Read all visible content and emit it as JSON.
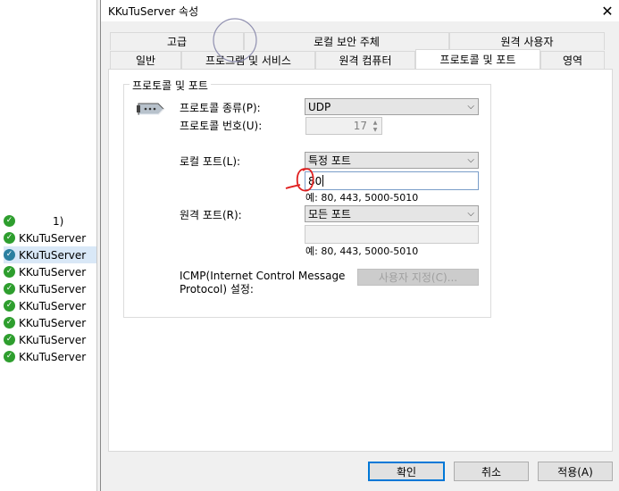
{
  "background_list": {
    "partial_label": "1)",
    "items": [
      "KKuTuServer",
      "KKuTuServer",
      "KKuTuServer",
      "KKuTuServer",
      "KKuTuServer",
      "KKuTuServer",
      "KKuTuServer",
      "KKuTuServer"
    ],
    "selected_index": 1
  },
  "dialog": {
    "title": "KKuTuServer 속성",
    "close_glyph": "✕",
    "tabs_top": [
      "고급",
      "로컬 보안 주체",
      "원격 사용자"
    ],
    "tabs_bottom": [
      "일반",
      "프로그램 및 서비스",
      "원격 컴퓨터",
      "프로토콜 및 포트",
      "영역"
    ],
    "active_tab": "프로토콜 및 포트",
    "group_title": "프로토콜 및 포트",
    "protocol_type_label": "프로토콜 종류(P):",
    "protocol_type_value": "UDP",
    "protocol_number_label": "프로토콜 번호(U):",
    "protocol_number_value": "17",
    "local_port_label": "로컬 포트(L):",
    "local_port_mode": "특정 포트",
    "local_port_value": "80",
    "local_port_hint": "예: 80, 443, 5000-5010",
    "remote_port_label": "원격 포트(R):",
    "remote_port_mode": "모든 포트",
    "remote_port_value": "",
    "remote_port_hint": "예: 80, 443, 5000-5010",
    "icmp_label_line1": "ICMP(Internet Control Message",
    "icmp_label_line2": "Protocol) 설정:",
    "customize_button": "사용자 지정(C)...",
    "ok_button": "확인",
    "cancel_button": "취소",
    "apply_button": "적용(A)"
  },
  "colors": {
    "annotation_red": "#e02020",
    "focus_blue": "#0078d7",
    "check_green": "#2e9e2e"
  }
}
